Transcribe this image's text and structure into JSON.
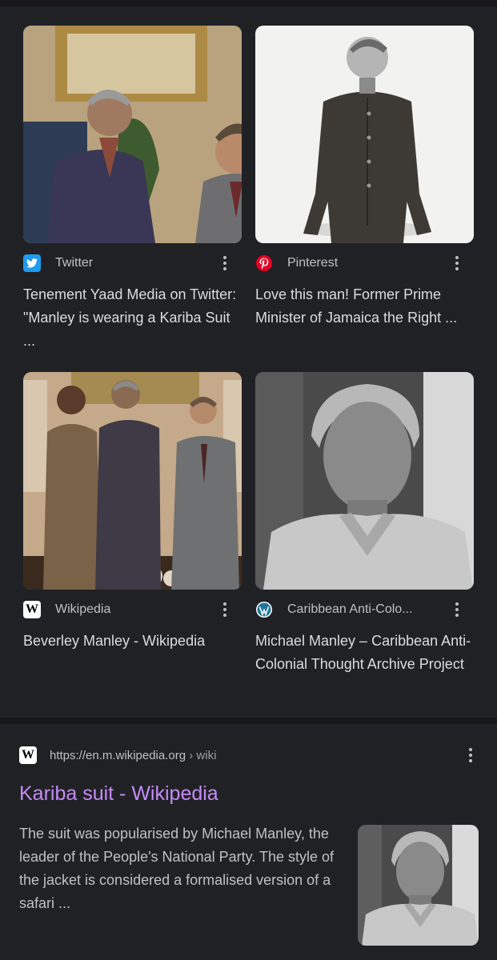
{
  "cards": [
    {
      "source": "Twitter",
      "source_icon": "twitter-icon",
      "title": "Tenement Yaad Media on Twitter: \"Manley is wearing a Kariba Suit ..."
    },
    {
      "source": "Pinterest",
      "source_icon": "pinterest-icon",
      "title": "Love this man! Former Prime Minister of Jamaica the Right ..."
    },
    {
      "source": "Wikipedia",
      "source_icon": "wikipedia-icon",
      "title": "Beverley Manley - Wikipedia"
    },
    {
      "source": "Caribbean Anti-Colo...",
      "source_icon": "wordpress-icon",
      "title": "Michael Manley – Caribbean Anti-Colonial Thought Archive Project"
    }
  ],
  "result": {
    "url": "https://en.m.wikipedia.org",
    "breadcrumb": " › wiki",
    "title": "Kariba suit - Wikipedia",
    "snippet": "The suit was popularised by Michael Manley, the leader of the People's National Party. The style of the jacket is considered a formalised version of a safari ...",
    "favicon_icon": "wikipedia-icon"
  },
  "colors": {
    "background": "#202124",
    "link_visited": "#c58af9",
    "twitter_blue": "#1d9bf0",
    "pinterest_red": "#e60023",
    "wordpress_blue": "#21759b"
  }
}
